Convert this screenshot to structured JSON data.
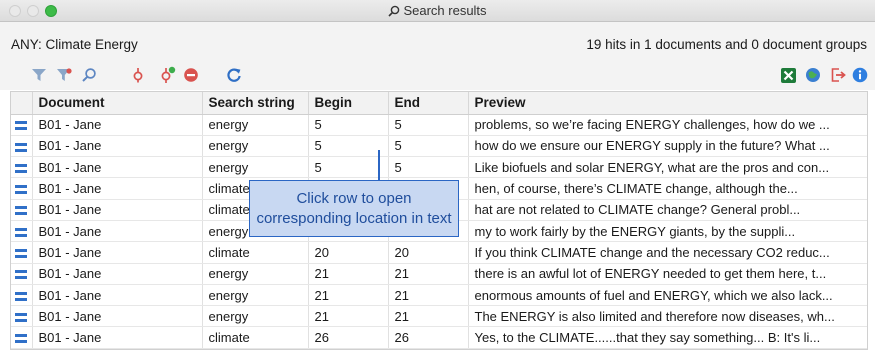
{
  "window": {
    "title": "Search results"
  },
  "header": {
    "query": "ANY: Climate Energy",
    "hits": "19 hits in 1 documents and 0 document groups"
  },
  "toolbar": {
    "icons": [
      "filter-icon",
      "filter-remove-icon",
      "search-icon",
      "code-icon",
      "code-add-icon",
      "remove-icon",
      "refresh-icon",
      "excel-export-icon",
      "web-icon",
      "export-icon",
      "info-icon"
    ],
    "colors": {
      "filter": "#8aa6c8",
      "code": "#d9534f",
      "refresh": "#2f6fc5",
      "excel": "#1e7b3a",
      "info": "#2f7fe0"
    }
  },
  "table": {
    "columns": [
      "",
      "Document",
      "Search string",
      "Begin",
      "End",
      "Preview"
    ],
    "rows": [
      {
        "document": "B01 - Jane",
        "search": "energy",
        "begin": "5",
        "end": "5",
        "preview": "problems, so we’re facing ENERGY challenges, how do we ..."
      },
      {
        "document": "B01 - Jane",
        "search": "energy",
        "begin": "5",
        "end": "5",
        "preview": "how do we ensure our ENERGY supply in the future? What ..."
      },
      {
        "document": "B01 - Jane",
        "search": "energy",
        "begin": "5",
        "end": "5",
        "preview": "Like biofuels and solar ENERGY, what are the pros and con..."
      },
      {
        "document": "B01 - Jane",
        "search": "climate",
        "begin": "",
        "end": "",
        "preview": "hen, of course, there’s CLIMATE change, although the..."
      },
      {
        "document": "B01 - Jane",
        "search": "climate",
        "begin": "",
        "end": "",
        "preview": "hat are not related to CLIMATE change? General probl..."
      },
      {
        "document": "B01 - Jane",
        "search": "energy",
        "begin": "",
        "end": "",
        "preview": "my to work fairly by the ENERGY giants, by the suppli..."
      },
      {
        "document": "B01 - Jane",
        "search": "climate",
        "begin": "20",
        "end": "20",
        "preview": "If you think CLIMATE change and the necessary CO2 reduc..."
      },
      {
        "document": "B01 - Jane",
        "search": "energy",
        "begin": "21",
        "end": "21",
        "preview": "there is an awful lot of ENERGY needed to get them here, t..."
      },
      {
        "document": "B01 - Jane",
        "search": "energy",
        "begin": "21",
        "end": "21",
        "preview": "enormous amounts of fuel and ENERGY, which we also lack..."
      },
      {
        "document": "B01 - Jane",
        "search": "energy",
        "begin": "21",
        "end": "21",
        "preview": "The ENERGY is also limited and therefore now diseases, wh..."
      },
      {
        "document": "B01 - Jane",
        "search": "climate",
        "begin": "26",
        "end": "26",
        "preview": "Yes, to the CLIMATE......that they say something...   B: It's li..."
      }
    ]
  },
  "callout": {
    "line1": "Click row to open",
    "line2": "corresponding location in text"
  }
}
